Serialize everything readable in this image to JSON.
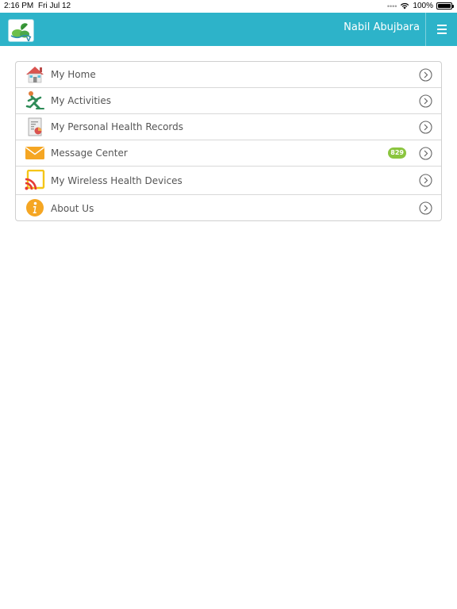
{
  "status_bar": {
    "time": "2:16 PM",
    "date": "Fri Jul 12",
    "battery": "100%",
    "battery_level": 1.0,
    "signal_icon": "cellular-dots-icon",
    "wifi_icon": "wifi-icon"
  },
  "header": {
    "logo_icon": "app-logo-icon",
    "user_name": "Nabil Abujbara",
    "menu_icon": "hamburger-menu-icon",
    "background_color": "#2db3c9"
  },
  "nav": {
    "items": [
      {
        "label": "My Home",
        "icon": "home-icon"
      },
      {
        "label": "My Activities",
        "icon": "running-person-icon"
      },
      {
        "label": "My Personal Health Records",
        "icon": "health-record-document-icon"
      },
      {
        "label": "Message Center",
        "icon": "envelope-icon",
        "badge": "829"
      },
      {
        "label": "My Wireless Health Devices",
        "icon": "wireless-device-icon"
      },
      {
        "label": "About Us",
        "icon": "info-icon"
      }
    ],
    "chevron_icon": "chevron-right-circle-icon",
    "badge_color": "#8bc53f"
  }
}
